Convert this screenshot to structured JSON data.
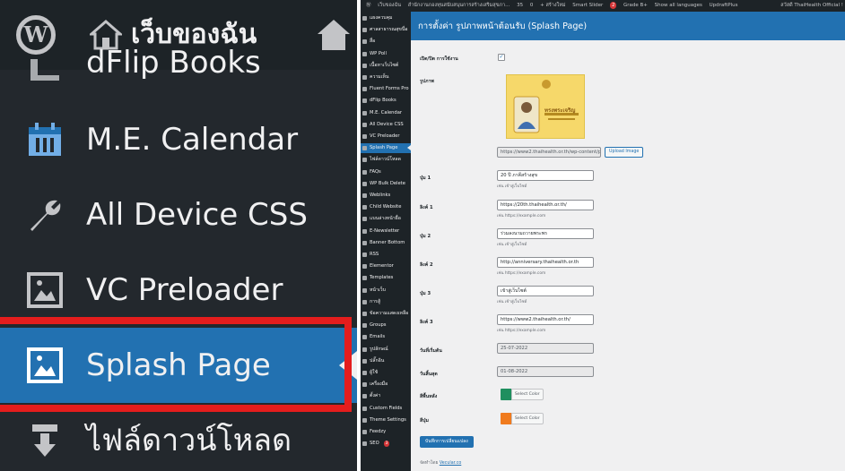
{
  "zoom": {
    "site_name": "เว็บของฉัน",
    "items": [
      {
        "label": "dFlip Books",
        "icon": "book-icon"
      },
      {
        "label": "M.E. Calendar",
        "icon": "calendar-icon"
      },
      {
        "label": "All Device CSS",
        "icon": "wrench-icon"
      },
      {
        "label": "VC Preloader",
        "icon": "image-icon"
      },
      {
        "label": "Splash Page",
        "icon": "image-icon"
      },
      {
        "label": "ไฟล์ดาวน์โหลด",
        "icon": "download-icon"
      }
    ]
  },
  "adminbar": {
    "site": "เว็บของฉัน",
    "org": "สำนักงานกองทุนสนับสนุนการสร้างเสริมสุขภา...",
    "updates": "35",
    "comments": "0",
    "new": "+ สร้างใหม่",
    "smart_slider": "Smart Slider",
    "badge": "2",
    "grade": "Grade B+",
    "languages": "Show all languages",
    "updraft": "UpdraftPlus",
    "user": "สวัสดี ThaiHealth Official !"
  },
  "sidebar": {
    "items": [
      "แผงควบคุม",
      "ศาลสาธารณสุขนื่อ",
      "สื่อ",
      "WP Poll",
      "เนื้อหาเว็บไซต์",
      "ความเห็น",
      "Fluent Forms Pro",
      "dFlip Books",
      "M.E. Calendar",
      "All Device CSS",
      "VC Preloader",
      "Splash Page",
      "ไฟล์ดาวน์โหลด",
      "FAQs",
      "WP Bulk Delete",
      "Weblinks",
      "Child Website",
      "แบนล่างหน้ายื่อ",
      "E-Newsletter",
      "Banner Bottom",
      "RSS",
      "Elementor",
      "Templates",
      "หน้าเว็บ",
      "การสู้",
      "ข้อความแสดงเหลือ",
      "Groups",
      "Emails",
      "รูปลักษณ์",
      "ปลั๊กอิน",
      "ผู้ใช้",
      "เครื่องมือ",
      "ตั้งค่า",
      "Custom Fields",
      "Theme Settings",
      "Feedzy",
      "SEO"
    ],
    "seo_badge": "3"
  },
  "page": {
    "title": "การตั้งค่า รูปภาพหน้าต้อนรับ (Splash Page)",
    "enable_label": "เปิด/ปิด การใช้งาน",
    "enable_check": "✓",
    "image_label": "รูปภาพ",
    "image_url": "https://www2.thaihealth.or.th/wp-content/p",
    "upload_button": "Upload Image",
    "image_poster_text": "ทรงพระเจริญ",
    "button1_label": "ปุ่ม 1",
    "button1_value": "20 ปี ภาคีสร้างสุข",
    "button1_desc": "เช่น เข้าสู่เว็บไซต์",
    "link1_label": "ลิงค์ 1",
    "link1_value": "https://20th.thaihealth.or.th/",
    "link1_desc": "เช่น https://example.com",
    "button2_label": "ปุ่ม 2",
    "button2_value": "ร่วมลงนามถวายพระพร",
    "button2_desc": "เช่น เข้าสู่เว็บไซต์",
    "link2_label": "ลิงค์ 2",
    "link2_value": "http://anniversary.thaihealth.or.th",
    "link2_desc": "เช่น https://example.com",
    "button3_label": "ปุ่ม 3",
    "button3_value": "เข้าสู่เว็บไซต์",
    "button3_desc": "เช่น เข้าสู่เว็บไซต์",
    "link3_label": "ลิงค์ 3",
    "link3_value": "https://www2.thaihealth.or.th/",
    "link3_desc": "เช่น https://example.com",
    "start_label": "วันที่เริ่มต้น",
    "start_value": "25-07-2022",
    "end_label": "วันสิ้นสุด",
    "end_value": "01-08-2022",
    "bgcolor_label": "สีพื้นหลัง",
    "bgcolor_value": "#1f8f5f",
    "btncolor_label": "สีปุ่ม",
    "btncolor_value": "#f07b1e",
    "select_color": "Select Color",
    "save_button": "บันทึกการเปลี่ยนแปลง",
    "footer_text": "จัดทำโดย",
    "footer_link": "Vecular.co"
  },
  "colors": {
    "admin_dark": "#1d2327",
    "admin_blue": "#2271b1",
    "highlight_red": "#e41d1d"
  }
}
